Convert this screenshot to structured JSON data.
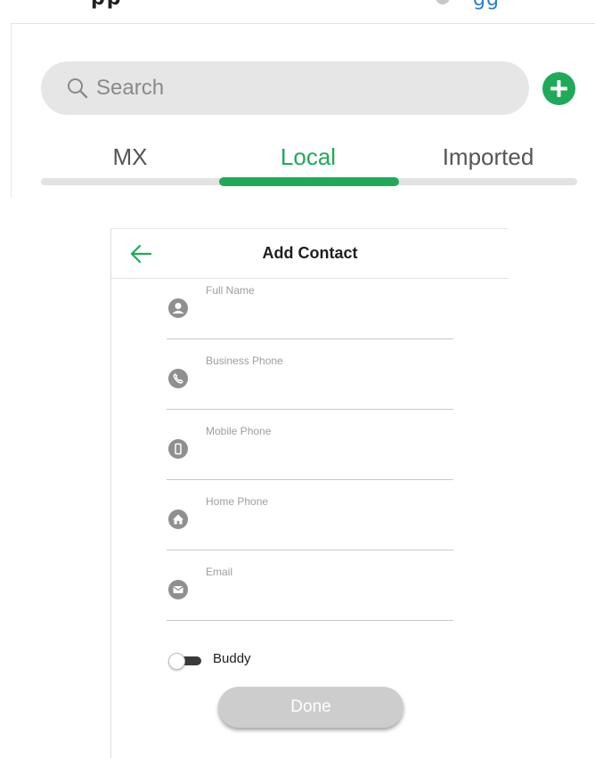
{
  "top": {
    "partial_title": "pp",
    "partial_link": "gg"
  },
  "search": {
    "placeholder": "Search"
  },
  "tabs": [
    {
      "label": "MX",
      "active": false
    },
    {
      "label": "Local",
      "active": true
    },
    {
      "label": "Imported",
      "active": false
    }
  ],
  "panel": {
    "title": "Add Contact",
    "fields": [
      {
        "label": "Full Name",
        "icon": "person-icon",
        "value": ""
      },
      {
        "label": "Business Phone",
        "icon": "phone-icon",
        "value": ""
      },
      {
        "label": "Mobile Phone",
        "icon": "mobile-icon",
        "value": ""
      },
      {
        "label": "Home Phone",
        "icon": "home-icon",
        "value": ""
      },
      {
        "label": "Email",
        "icon": "mail-icon",
        "value": ""
      }
    ],
    "buddy": {
      "label": "Buddy",
      "enabled": false
    },
    "done_label": "Done"
  },
  "colors": {
    "accent": "#1faa59",
    "icon_gray": "#8f8f8f",
    "search_bg": "#e6e6e6",
    "done_bg": "#cdcdcd"
  }
}
